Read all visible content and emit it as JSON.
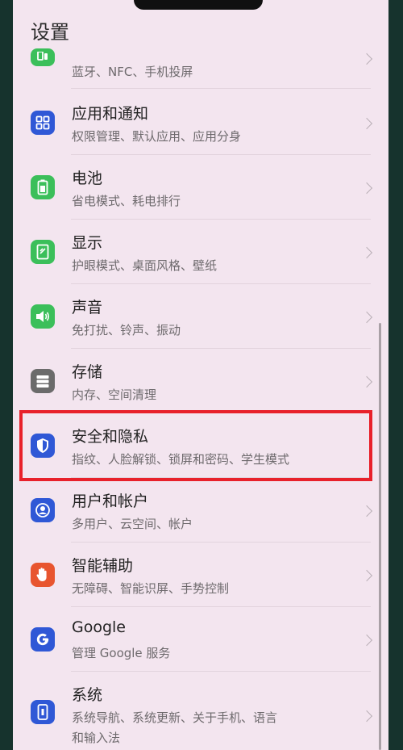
{
  "header": {
    "title": "设置"
  },
  "items": [
    {
      "id": "connections",
      "title": "",
      "subtitle": "蓝牙、NFC、手机投屏",
      "icon": "devices-connection-icon",
      "color": "#3bbf5a"
    },
    {
      "id": "apps",
      "title": "应用和通知",
      "subtitle": "权限管理、默认应用、应用分身",
      "icon": "apps-grid-icon",
      "color": "#2f58d6"
    },
    {
      "id": "battery",
      "title": "电池",
      "subtitle": "省电模式、耗电排行",
      "icon": "battery-icon",
      "color": "#3bbf5a"
    },
    {
      "id": "display",
      "title": "显示",
      "subtitle": "护眼模式、桌面风格、壁纸",
      "icon": "display-icon",
      "color": "#3bbf5a"
    },
    {
      "id": "sound",
      "title": "声音",
      "subtitle": "免打扰、铃声、振动",
      "icon": "speaker-icon",
      "color": "#3bbf5a"
    },
    {
      "id": "storage",
      "title": "存储",
      "subtitle": "内存、空间清理",
      "icon": "storage-icon",
      "color": "#6b6b6b"
    },
    {
      "id": "security",
      "title": "安全和隐私",
      "subtitle": "指纹、人脸解锁、锁屏和密码、学生模式",
      "icon": "shield-icon",
      "color": "#2f58d6"
    },
    {
      "id": "accounts",
      "title": "用户和帐户",
      "subtitle": "多用户、云空间、帐户",
      "icon": "user-account-icon",
      "color": "#2f58d6"
    },
    {
      "id": "accessibility",
      "title": "智能辅助",
      "subtitle": "无障碍、智能识屏、手势控制",
      "icon": "hand-icon",
      "color": "#e8552f"
    },
    {
      "id": "google",
      "title": "Google",
      "subtitle": "管理 Google 服务",
      "icon": "google-icon",
      "color": "#2f58d6"
    },
    {
      "id": "system",
      "title": "系统",
      "subtitle": "系统导航、系统更新、关于手机、语言",
      "subtitle2": "和输入法",
      "icon": "phone-system-icon",
      "color": "#2f58d6"
    }
  ]
}
